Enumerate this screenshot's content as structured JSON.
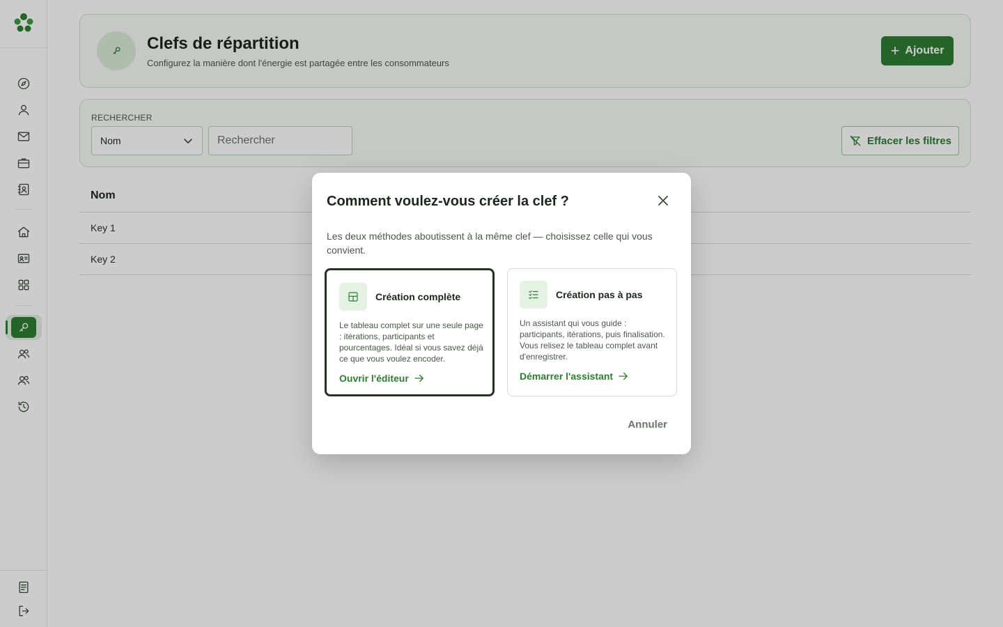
{
  "sidebar": {
    "items": [
      {
        "name": "compass-icon"
      },
      {
        "name": "user-icon"
      },
      {
        "name": "mail-icon"
      },
      {
        "name": "briefcase-icon"
      },
      {
        "name": "contact-book-icon"
      },
      {
        "name": "home-icon"
      },
      {
        "name": "id-card-icon"
      },
      {
        "name": "grid-icon"
      },
      {
        "name": "key-icon",
        "active": true
      },
      {
        "name": "users-icon"
      },
      {
        "name": "group-icon"
      },
      {
        "name": "history-icon"
      },
      {
        "name": "document-icon"
      },
      {
        "name": "logout-icon"
      }
    ]
  },
  "header": {
    "title": "Clefs de répartition",
    "subtitle": "Configurez la manière dont l'énergie est partagée entre les consommateurs",
    "add_label": "Ajouter"
  },
  "filters": {
    "label": "RECHERCHER",
    "select_value": "Nom",
    "search_placeholder": "Rechercher",
    "clear_label": "Effacer les filtres"
  },
  "table": {
    "header": "Nom",
    "rows": [
      "Key 1",
      "Key 2"
    ]
  },
  "modal": {
    "title": "Comment voulez-vous créer la clef ?",
    "description": "Les deux méthodes aboutissent à la même clef — choisissez celle qui vous convient.",
    "options": [
      {
        "title": "Création complète",
        "description": "Le tableau complet sur une seule page : itérations, participants et pourcentages. Idéal si vous savez déjà ce que vous voulez encoder.",
        "link": "Ouvrir l'éditeur",
        "selected": true
      },
      {
        "title": "Création pas à pas",
        "description": "Un assistant qui vous guide : participants, itérations, puis finalisation. Vous relisez le tableau complet avant d'enregistrer.",
        "link": "Démarrer l'assistant",
        "selected": false
      }
    ],
    "cancel_label": "Annuler"
  },
  "colors": {
    "accent": "#2e7d32",
    "accent_light": "#e4f1e3",
    "card_bg": "#f7fbf6",
    "card_border": "#cfe0cf"
  }
}
